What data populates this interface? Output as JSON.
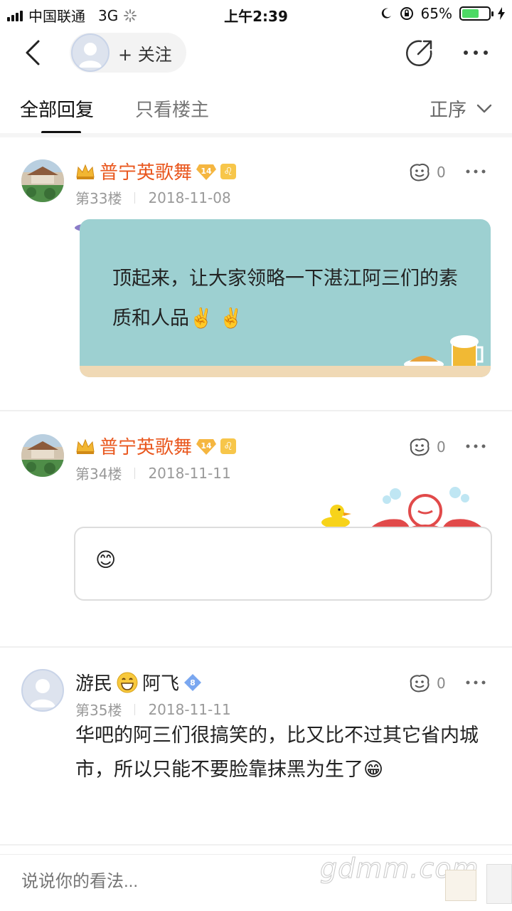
{
  "status_bar": {
    "carrier": "中国联通",
    "network": "3G",
    "time": "上午2:39",
    "battery": "65%",
    "battery_level": 0.65
  },
  "nav": {
    "follow_label": "+ 关注"
  },
  "tabs": {
    "all_replies": "全部回复",
    "owner_only": "只看楼主",
    "sort_label": "正序"
  },
  "posts": [
    {
      "username": "普宁英歌舞",
      "level": "14",
      "floor": "第33楼",
      "date": "2018-11-08",
      "likes": "0",
      "content": "顶起来，让大家领略一下湛江阿三们的素质和人品✌️ ✌️"
    },
    {
      "username": "普宁英歌舞",
      "level": "14",
      "floor": "第34楼",
      "date": "2018-11-11",
      "likes": "0",
      "content": "😊"
    },
    {
      "username_prefix": "游民",
      "username_suffix": "阿飞",
      "level": "8",
      "floor": "第35楼",
      "date": "2018-11-11",
      "likes": "0",
      "content": "华吧的阿三们很搞笑的，比又比不过其它省内城市，所以只能不要脸靠抹黑为生了😁"
    }
  ],
  "bottom_bar": {
    "placeholder": "说说你的看法..."
  },
  "watermark": "gdmm.com",
  "colors": {
    "username_accent": "#e9571e",
    "bubble_teal": "#9dd0d1",
    "level_badge": "#f7c64a",
    "level_badge_blue": "#7aa7f0"
  }
}
